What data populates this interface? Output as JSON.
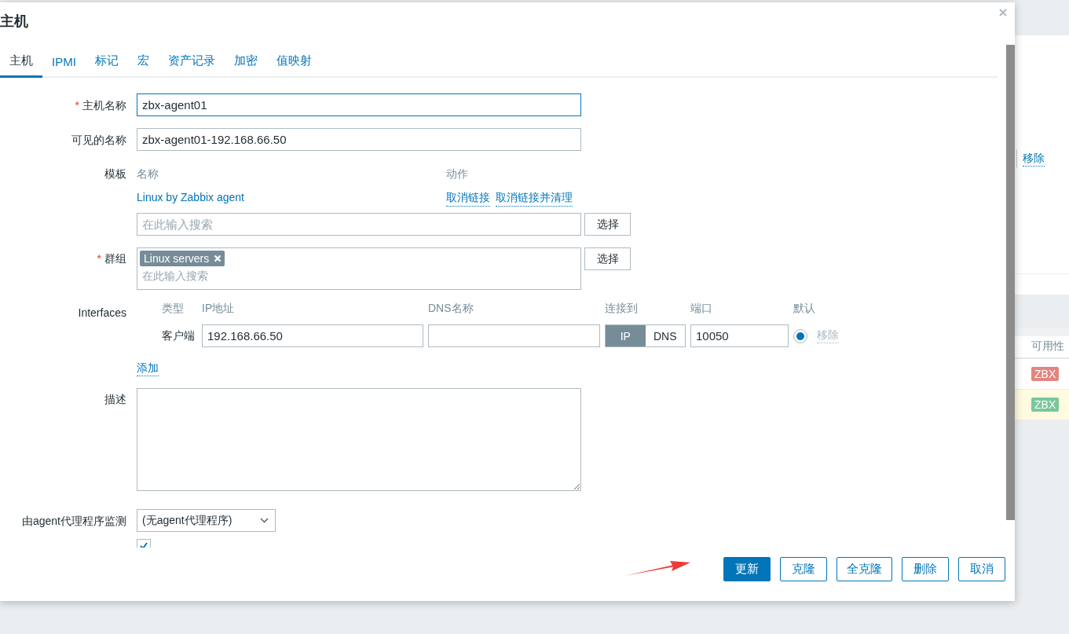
{
  "dialog": {
    "title": "主机"
  },
  "tabs": [
    {
      "label": "主机",
      "selected": true
    },
    {
      "label": "IPMI",
      "selected": false
    },
    {
      "label": "标记",
      "selected": false
    },
    {
      "label": "宏",
      "selected": false
    },
    {
      "label": "资产记录",
      "selected": false
    },
    {
      "label": "加密",
      "selected": false
    },
    {
      "label": "值映射",
      "selected": false
    }
  ],
  "host_name": {
    "label": "主机名称",
    "required_mark": "*",
    "value": "zbx-agent01"
  },
  "visible_name": {
    "label": "可见的名称",
    "value": "zbx-agent01-192.168.66.50"
  },
  "templates": {
    "label": "模板",
    "columns": [
      "名称",
      "动作"
    ],
    "rows": [
      {
        "name": "Linux by Zabbix agent",
        "actions": [
          "取消链接",
          "取消链接并清理"
        ]
      }
    ],
    "placeholder": "在此输入搜索",
    "select_button": "选择"
  },
  "groups": {
    "label": "群组",
    "required_mark": "*",
    "tags": [
      "Linux servers"
    ],
    "placeholder": "在此输入搜索",
    "select_button": "选择"
  },
  "interfaces": {
    "label": "Interfaces",
    "columns": [
      "类型",
      "IP地址",
      "DNS名称",
      "连接到",
      "端口",
      "默认"
    ],
    "rows": [
      {
        "type": "客户端",
        "ip": "192.168.66.50",
        "connect": [
          {
            "label": "IP",
            "selected": true
          },
          {
            "label": "DNS",
            "selected": false
          }
        ],
        "port": "10050",
        "default": true,
        "remove": "移除"
      }
    ],
    "add": "添加"
  },
  "description": {
    "label": "描述"
  },
  "proxy": {
    "label": "由agent代理程序监测",
    "value": "(无agent代理程序)"
  },
  "enabled": {
    "checked": true
  },
  "buttons": [
    {
      "label": "更新",
      "kind": "primary"
    },
    {
      "label": "克隆",
      "kind": "secondary"
    },
    {
      "label": "全克隆",
      "kind": "secondary"
    },
    {
      "label": "删除",
      "kind": "secondary"
    },
    {
      "label": "取消",
      "kind": "secondary"
    }
  ],
  "background": {
    "remove_link": "移除",
    "column": "可用性",
    "rows": [
      {
        "badge": "ZBX",
        "color": "#e38580",
        "highlighted": false
      },
      {
        "badge": "ZBX",
        "color": "#79c79a",
        "highlighted": true
      }
    ]
  }
}
